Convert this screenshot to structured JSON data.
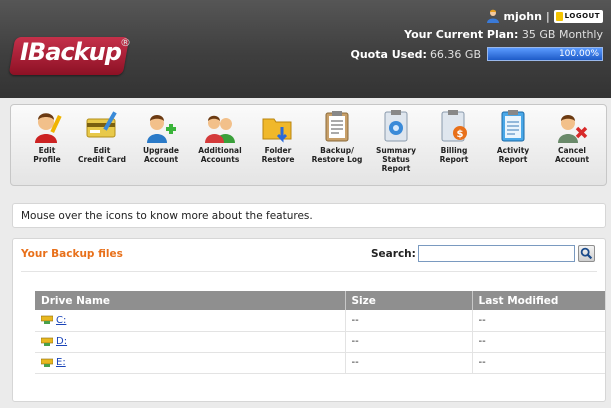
{
  "header": {
    "logo_text": "IBackup",
    "logo_mark": "®",
    "username": "mjohn",
    "separator": "|",
    "logout_label": "LOGOUT",
    "plan_label": "Your Current Plan:",
    "plan_value": "35 GB Monthly",
    "quota_label": "Quota Used:",
    "quota_value": "66.36 GB",
    "quota_percent_text": "100.00%",
    "quota_fraction": 1.0
  },
  "toolbar": {
    "items": [
      {
        "label": "Edit\nProfile",
        "icon": "edit-profile-icon"
      },
      {
        "label": "Edit\nCredit Card",
        "icon": "credit-card-icon"
      },
      {
        "label": "Upgrade\nAccount",
        "icon": "upgrade-account-icon"
      },
      {
        "label": "Additional\nAccounts",
        "icon": "additional-accounts-icon"
      },
      {
        "label": "Folder\nRestore",
        "icon": "folder-restore-icon"
      },
      {
        "label": "Backup/\nRestore Log",
        "icon": "backup-log-icon"
      },
      {
        "label": "Summary\nStatus Report",
        "icon": "summary-report-icon"
      },
      {
        "label": "Billing\nReport",
        "icon": "billing-report-icon"
      },
      {
        "label": "Activity\nReport",
        "icon": "activity-report-icon"
      },
      {
        "label": "Cancel\nAccount",
        "icon": "cancel-account-icon"
      }
    ]
  },
  "info": {
    "text": "Mouse over the icons to know more about the features."
  },
  "files": {
    "title": "Your Backup files",
    "search_label": "Search:",
    "search_value": "",
    "columns": [
      "Drive Name",
      "Size",
      "Last Modified"
    ],
    "rows": [
      {
        "drive": "C:",
        "size": "--",
        "modified": "--"
      },
      {
        "drive": "D:",
        "size": "--",
        "modified": "--"
      },
      {
        "drive": "E:",
        "size": "--",
        "modified": "--"
      }
    ]
  },
  "colors": {
    "accent_orange": "#e8701a",
    "quota_bar_blue": "#2f6fd6",
    "table_header_gray": "#8f8f8f",
    "link_blue": "#1a44b8"
  }
}
